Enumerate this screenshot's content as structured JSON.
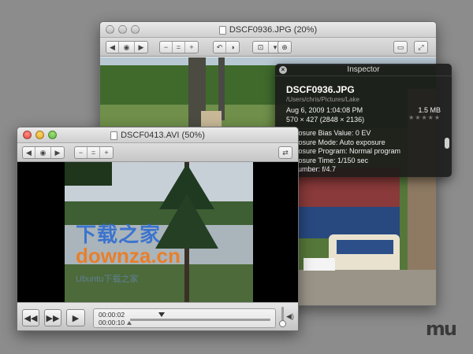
{
  "photo_window": {
    "title": "DSCF0936.JPG (20%)"
  },
  "inspector": {
    "title": "Inspector",
    "file_name": "DSCF0936.JPG",
    "file_path": "/Users/chris/Pictures/Lake",
    "date": "Aug 6, 2009 1:04:08 PM",
    "file_size": "1.5 MB",
    "dimensions": "570 × 427 (2848 × 2136)",
    "rating_stars": "★★★★★",
    "exif": [
      "Exposure Bias Value: 0 EV",
      "Exposure Mode: Auto exposure",
      "Exposure Program: Normal program",
      "Exposure Time: 1/150 sec",
      "F-Number: f/4.7"
    ]
  },
  "video_window": {
    "title": "DSCF0413.AVI (50%)",
    "current_time": "00:00:02",
    "duration": "00:00:10"
  },
  "watermark": {
    "chinese": "下载之家",
    "latin": "downza.cn",
    "url": "Ubuntu下载之家"
  },
  "corner_logo": "mu",
  "colors": {
    "desktop": "#8c8c8c",
    "hud_bg": "#191919",
    "watermark_blue": "#2f6ed1",
    "watermark_orange": "#f07a1a"
  }
}
